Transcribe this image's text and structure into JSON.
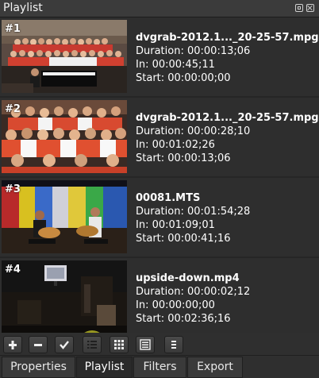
{
  "window": {
    "title": "Playlist"
  },
  "playlist": {
    "items": [
      {
        "number": "#1",
        "name": "dvgrab-2012.1..._20-25-57.mpg",
        "duration": "Duration: 00:00:13;06",
        "in": "In: 00:00:45;11",
        "start": "Start: 00:00:00;00",
        "thumbnail": "choir-with-piano"
      },
      {
        "number": "#2",
        "name": "dvgrab-2012.1..._20-25-57.mpg",
        "duration": "Duration: 00:00:28;10",
        "in": "In: 00:01:02;26",
        "start": "Start: 00:00:13;06",
        "thumbnail": "choir-closeup"
      },
      {
        "number": "#3",
        "name": "00081.MTS",
        "duration": "Duration: 00:01:54;28",
        "in": "In: 00:01:09;01",
        "start": "Start: 00:00:41;16",
        "thumbnail": "guitar-duo-on-stage"
      },
      {
        "number": "#4",
        "name": "upside-down.mp4",
        "duration": "Duration: 00:00:02;12",
        "in": "In: 00:00:00;00",
        "start": "Start: 00:02:36;16",
        "thumbnail": "dark-room-with-monitor"
      }
    ]
  },
  "toolbar": {
    "buttons": [
      {
        "icon": "plus-icon"
      },
      {
        "icon": "minus-icon"
      },
      {
        "icon": "checkmark-icon"
      },
      {
        "icon": "details-view-icon"
      },
      {
        "icon": "tiles-view-icon"
      },
      {
        "icon": "icon-view-icon"
      },
      {
        "icon": "menu-icon"
      }
    ],
    "highlight_color": "#c8c828"
  },
  "tabs": [
    {
      "label": "Properties",
      "active": false
    },
    {
      "label": "Playlist",
      "active": true
    },
    {
      "label": "Filters",
      "active": false
    },
    {
      "label": "Export",
      "active": false
    }
  ],
  "colors": {
    "background": "#2f2f2f",
    "item_background": "#2e2e2e",
    "text": "#ffffff"
  }
}
